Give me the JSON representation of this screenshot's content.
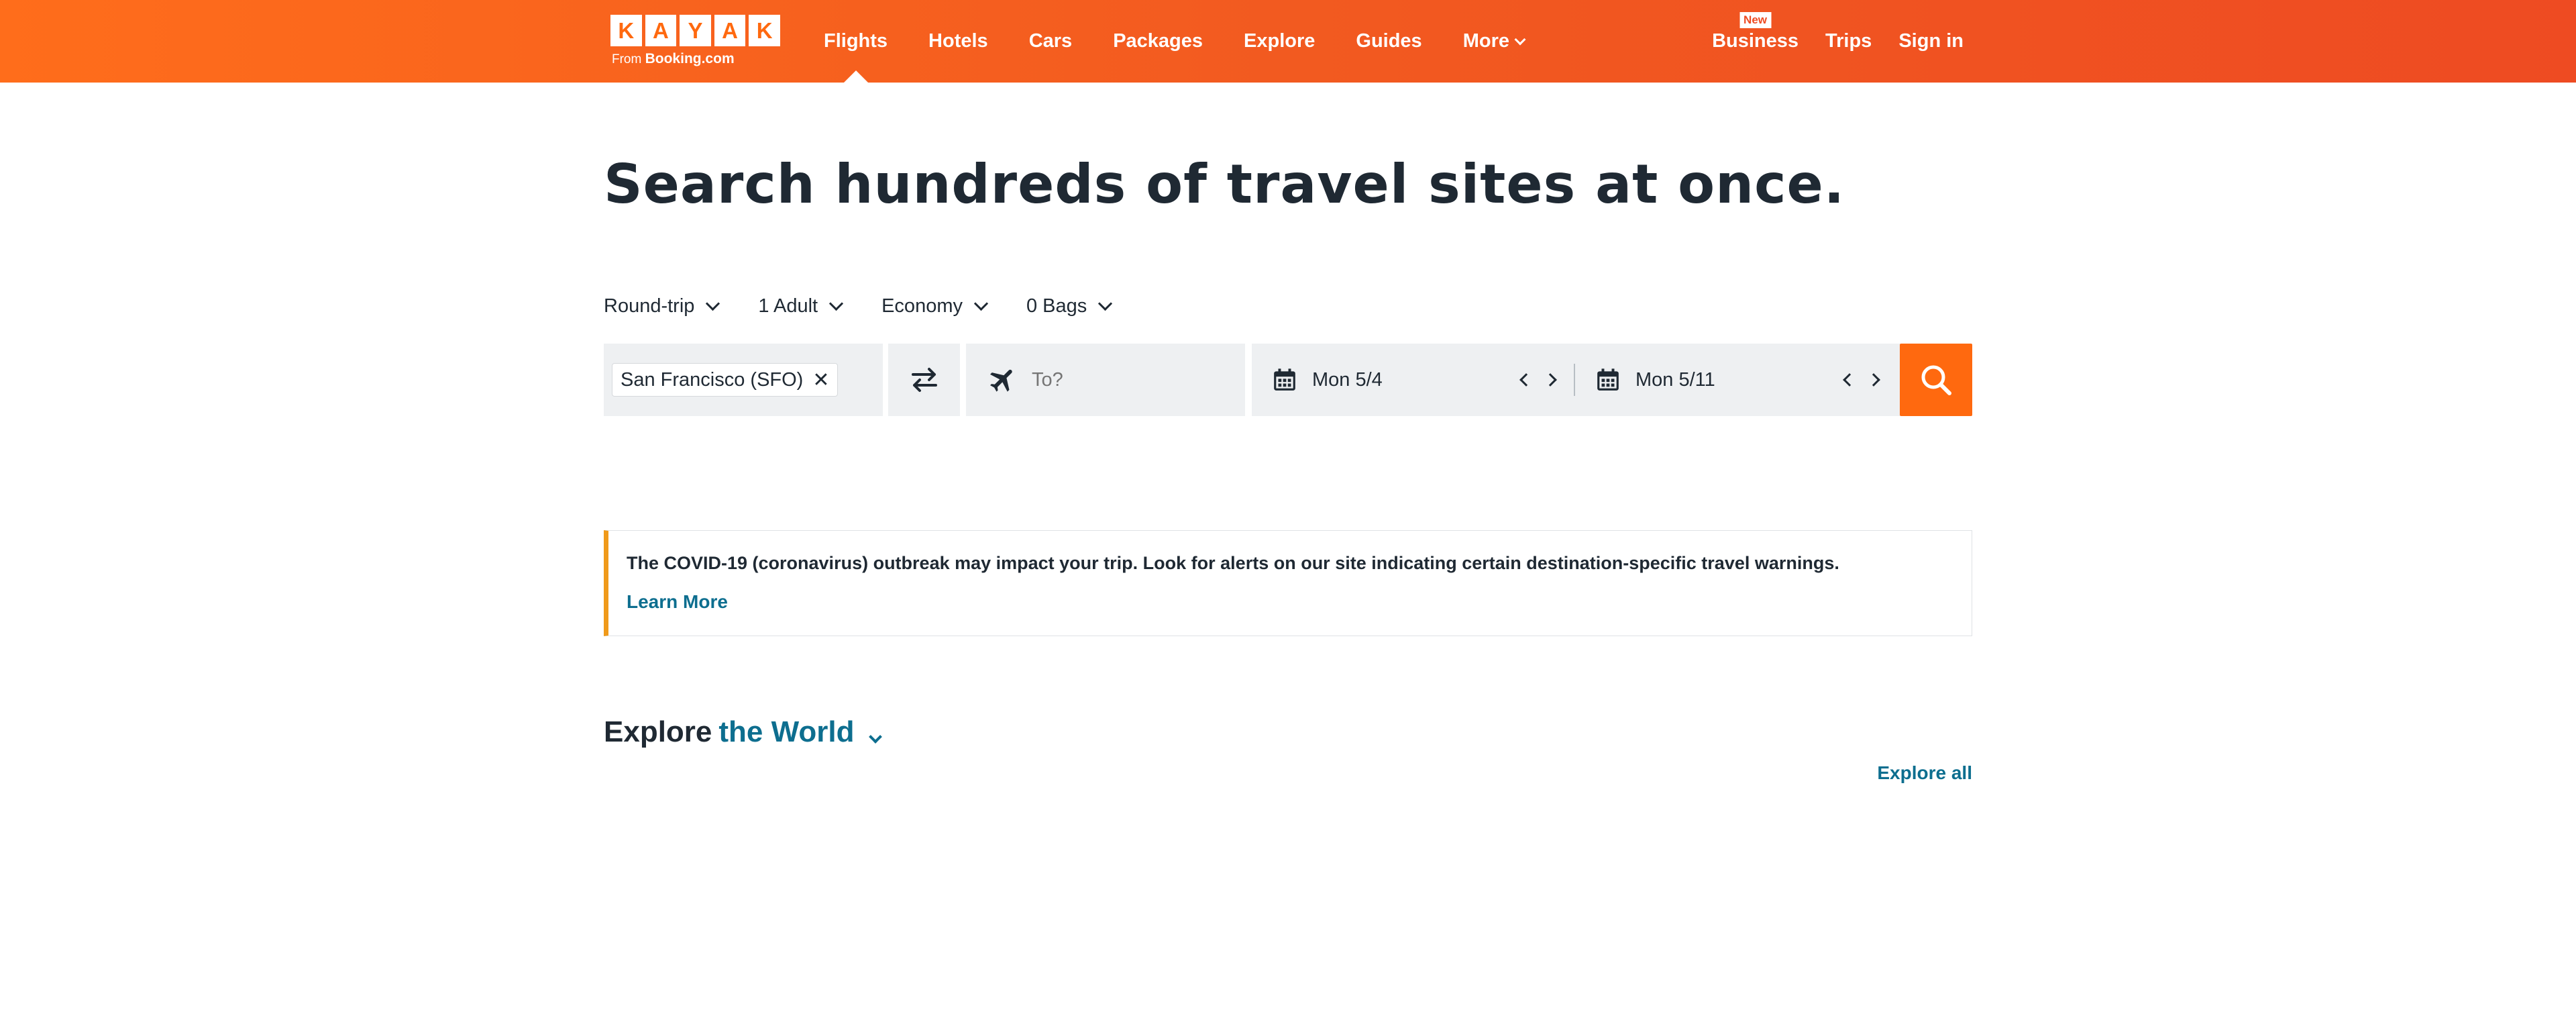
{
  "header": {
    "logo_letters": [
      "K",
      "A",
      "Y",
      "A",
      "K"
    ],
    "logo_from": "From",
    "logo_brand": "Booking.com",
    "nav": [
      {
        "label": "Flights",
        "active": true
      },
      {
        "label": "Hotels"
      },
      {
        "label": "Cars"
      },
      {
        "label": "Packages"
      },
      {
        "label": "Explore"
      },
      {
        "label": "Guides"
      },
      {
        "label": "More"
      }
    ],
    "right": {
      "business_badge": "New",
      "business": "Business",
      "trips": "Trips",
      "signin": "Sign in"
    }
  },
  "headline": "Search hundreds of travel sites at once.",
  "options": {
    "trip_type": "Round-trip",
    "travelers": "1 Adult",
    "cabin": "Economy",
    "bags": "0 Bags"
  },
  "search": {
    "origin": "San Francisco (SFO)",
    "destination_placeholder": "To?",
    "depart_date": "Mon 5/4",
    "return_date": "Mon 5/11"
  },
  "notice": {
    "text": "The COVID-19 (coronavirus) outbreak may impact your trip. Look for alerts on our site indicating certain destination-specific travel warnings.",
    "link": "Learn More"
  },
  "explore": {
    "title_prefix": "Explore",
    "title_accent": "the World",
    "all_link": "Explore all"
  },
  "colors": {
    "brand_orange": "#ff690f",
    "link_teal": "#0d6e8f",
    "notice_accent": "#f09a1a"
  }
}
